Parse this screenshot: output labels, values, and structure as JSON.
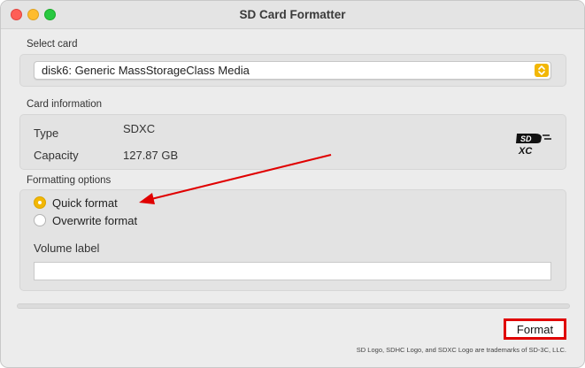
{
  "window": {
    "title": "SD Card Formatter"
  },
  "select_card": {
    "label": "Select card",
    "value": "disk6: Generic MassStorageClass Media",
    "chevron_icon": "up-down-chevron-icon"
  },
  "card_info": {
    "label": "Card information",
    "type_label": "Type",
    "type_value": "SDXC",
    "capacity_label": "Capacity",
    "capacity_value": "127.87 GB",
    "logo_icon": "sdxc-logo-icon"
  },
  "formatting": {
    "label": "Formatting options",
    "options": [
      {
        "label": "Quick format",
        "checked": true
      },
      {
        "label": "Overwrite format",
        "checked": false
      }
    ],
    "volume_label": "Volume label",
    "volume_value": ""
  },
  "progress": {
    "value": 0
  },
  "actions": {
    "format_label": "Format"
  },
  "footer": {
    "trademark": "SD Logo, SDHC Logo, and SDXC Logo are trademarks of SD-3C, LLC."
  },
  "colors": {
    "accent": "#f2b705",
    "annotation": "#e00000"
  }
}
